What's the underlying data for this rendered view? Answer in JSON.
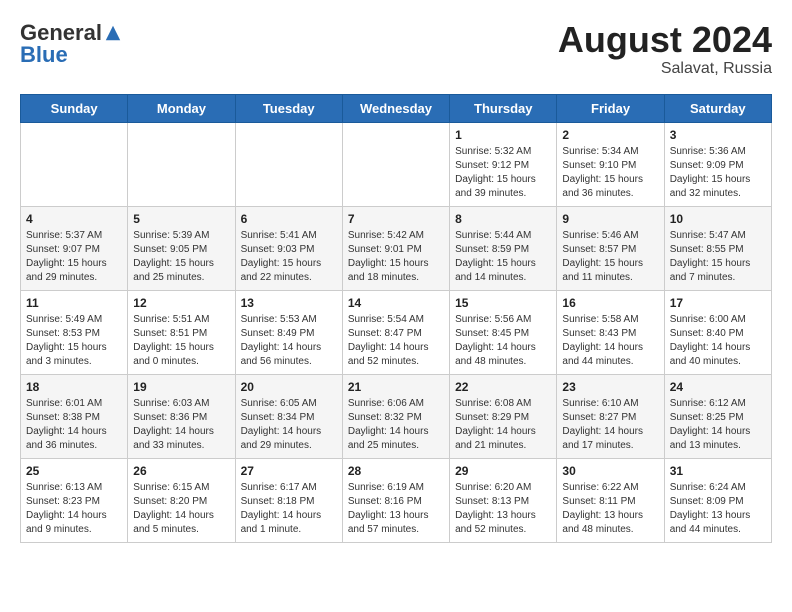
{
  "header": {
    "logo_general": "General",
    "logo_blue": "Blue",
    "month_year": "August 2024",
    "location": "Salavat, Russia"
  },
  "days_of_week": [
    "Sunday",
    "Monday",
    "Tuesday",
    "Wednesday",
    "Thursday",
    "Friday",
    "Saturday"
  ],
  "weeks": [
    {
      "cells": [
        {
          "day": "",
          "info": ""
        },
        {
          "day": "",
          "info": ""
        },
        {
          "day": "",
          "info": ""
        },
        {
          "day": "",
          "info": ""
        },
        {
          "day": "1",
          "info": "Sunrise: 5:32 AM\nSunset: 9:12 PM\nDaylight: 15 hours\nand 39 minutes."
        },
        {
          "day": "2",
          "info": "Sunrise: 5:34 AM\nSunset: 9:10 PM\nDaylight: 15 hours\nand 36 minutes."
        },
        {
          "day": "3",
          "info": "Sunrise: 5:36 AM\nSunset: 9:09 PM\nDaylight: 15 hours\nand 32 minutes."
        }
      ]
    },
    {
      "cells": [
        {
          "day": "4",
          "info": "Sunrise: 5:37 AM\nSunset: 9:07 PM\nDaylight: 15 hours\nand 29 minutes."
        },
        {
          "day": "5",
          "info": "Sunrise: 5:39 AM\nSunset: 9:05 PM\nDaylight: 15 hours\nand 25 minutes."
        },
        {
          "day": "6",
          "info": "Sunrise: 5:41 AM\nSunset: 9:03 PM\nDaylight: 15 hours\nand 22 minutes."
        },
        {
          "day": "7",
          "info": "Sunrise: 5:42 AM\nSunset: 9:01 PM\nDaylight: 15 hours\nand 18 minutes."
        },
        {
          "day": "8",
          "info": "Sunrise: 5:44 AM\nSunset: 8:59 PM\nDaylight: 15 hours\nand 14 minutes."
        },
        {
          "day": "9",
          "info": "Sunrise: 5:46 AM\nSunset: 8:57 PM\nDaylight: 15 hours\nand 11 minutes."
        },
        {
          "day": "10",
          "info": "Sunrise: 5:47 AM\nSunset: 8:55 PM\nDaylight: 15 hours\nand 7 minutes."
        }
      ]
    },
    {
      "cells": [
        {
          "day": "11",
          "info": "Sunrise: 5:49 AM\nSunset: 8:53 PM\nDaylight: 15 hours\nand 3 minutes."
        },
        {
          "day": "12",
          "info": "Sunrise: 5:51 AM\nSunset: 8:51 PM\nDaylight: 15 hours\nand 0 minutes."
        },
        {
          "day": "13",
          "info": "Sunrise: 5:53 AM\nSunset: 8:49 PM\nDaylight: 14 hours\nand 56 minutes."
        },
        {
          "day": "14",
          "info": "Sunrise: 5:54 AM\nSunset: 8:47 PM\nDaylight: 14 hours\nand 52 minutes."
        },
        {
          "day": "15",
          "info": "Sunrise: 5:56 AM\nSunset: 8:45 PM\nDaylight: 14 hours\nand 48 minutes."
        },
        {
          "day": "16",
          "info": "Sunrise: 5:58 AM\nSunset: 8:43 PM\nDaylight: 14 hours\nand 44 minutes."
        },
        {
          "day": "17",
          "info": "Sunrise: 6:00 AM\nSunset: 8:40 PM\nDaylight: 14 hours\nand 40 minutes."
        }
      ]
    },
    {
      "cells": [
        {
          "day": "18",
          "info": "Sunrise: 6:01 AM\nSunset: 8:38 PM\nDaylight: 14 hours\nand 36 minutes."
        },
        {
          "day": "19",
          "info": "Sunrise: 6:03 AM\nSunset: 8:36 PM\nDaylight: 14 hours\nand 33 minutes."
        },
        {
          "day": "20",
          "info": "Sunrise: 6:05 AM\nSunset: 8:34 PM\nDaylight: 14 hours\nand 29 minutes."
        },
        {
          "day": "21",
          "info": "Sunrise: 6:06 AM\nSunset: 8:32 PM\nDaylight: 14 hours\nand 25 minutes."
        },
        {
          "day": "22",
          "info": "Sunrise: 6:08 AM\nSunset: 8:29 PM\nDaylight: 14 hours\nand 21 minutes."
        },
        {
          "day": "23",
          "info": "Sunrise: 6:10 AM\nSunset: 8:27 PM\nDaylight: 14 hours\nand 17 minutes."
        },
        {
          "day": "24",
          "info": "Sunrise: 6:12 AM\nSunset: 8:25 PM\nDaylight: 14 hours\nand 13 minutes."
        }
      ]
    },
    {
      "cells": [
        {
          "day": "25",
          "info": "Sunrise: 6:13 AM\nSunset: 8:23 PM\nDaylight: 14 hours\nand 9 minutes."
        },
        {
          "day": "26",
          "info": "Sunrise: 6:15 AM\nSunset: 8:20 PM\nDaylight: 14 hours\nand 5 minutes."
        },
        {
          "day": "27",
          "info": "Sunrise: 6:17 AM\nSunset: 8:18 PM\nDaylight: 14 hours\nand 1 minute."
        },
        {
          "day": "28",
          "info": "Sunrise: 6:19 AM\nSunset: 8:16 PM\nDaylight: 13 hours\nand 57 minutes."
        },
        {
          "day": "29",
          "info": "Sunrise: 6:20 AM\nSunset: 8:13 PM\nDaylight: 13 hours\nand 52 minutes."
        },
        {
          "day": "30",
          "info": "Sunrise: 6:22 AM\nSunset: 8:11 PM\nDaylight: 13 hours\nand 48 minutes."
        },
        {
          "day": "31",
          "info": "Sunrise: 6:24 AM\nSunset: 8:09 PM\nDaylight: 13 hours\nand 44 minutes."
        }
      ]
    }
  ]
}
